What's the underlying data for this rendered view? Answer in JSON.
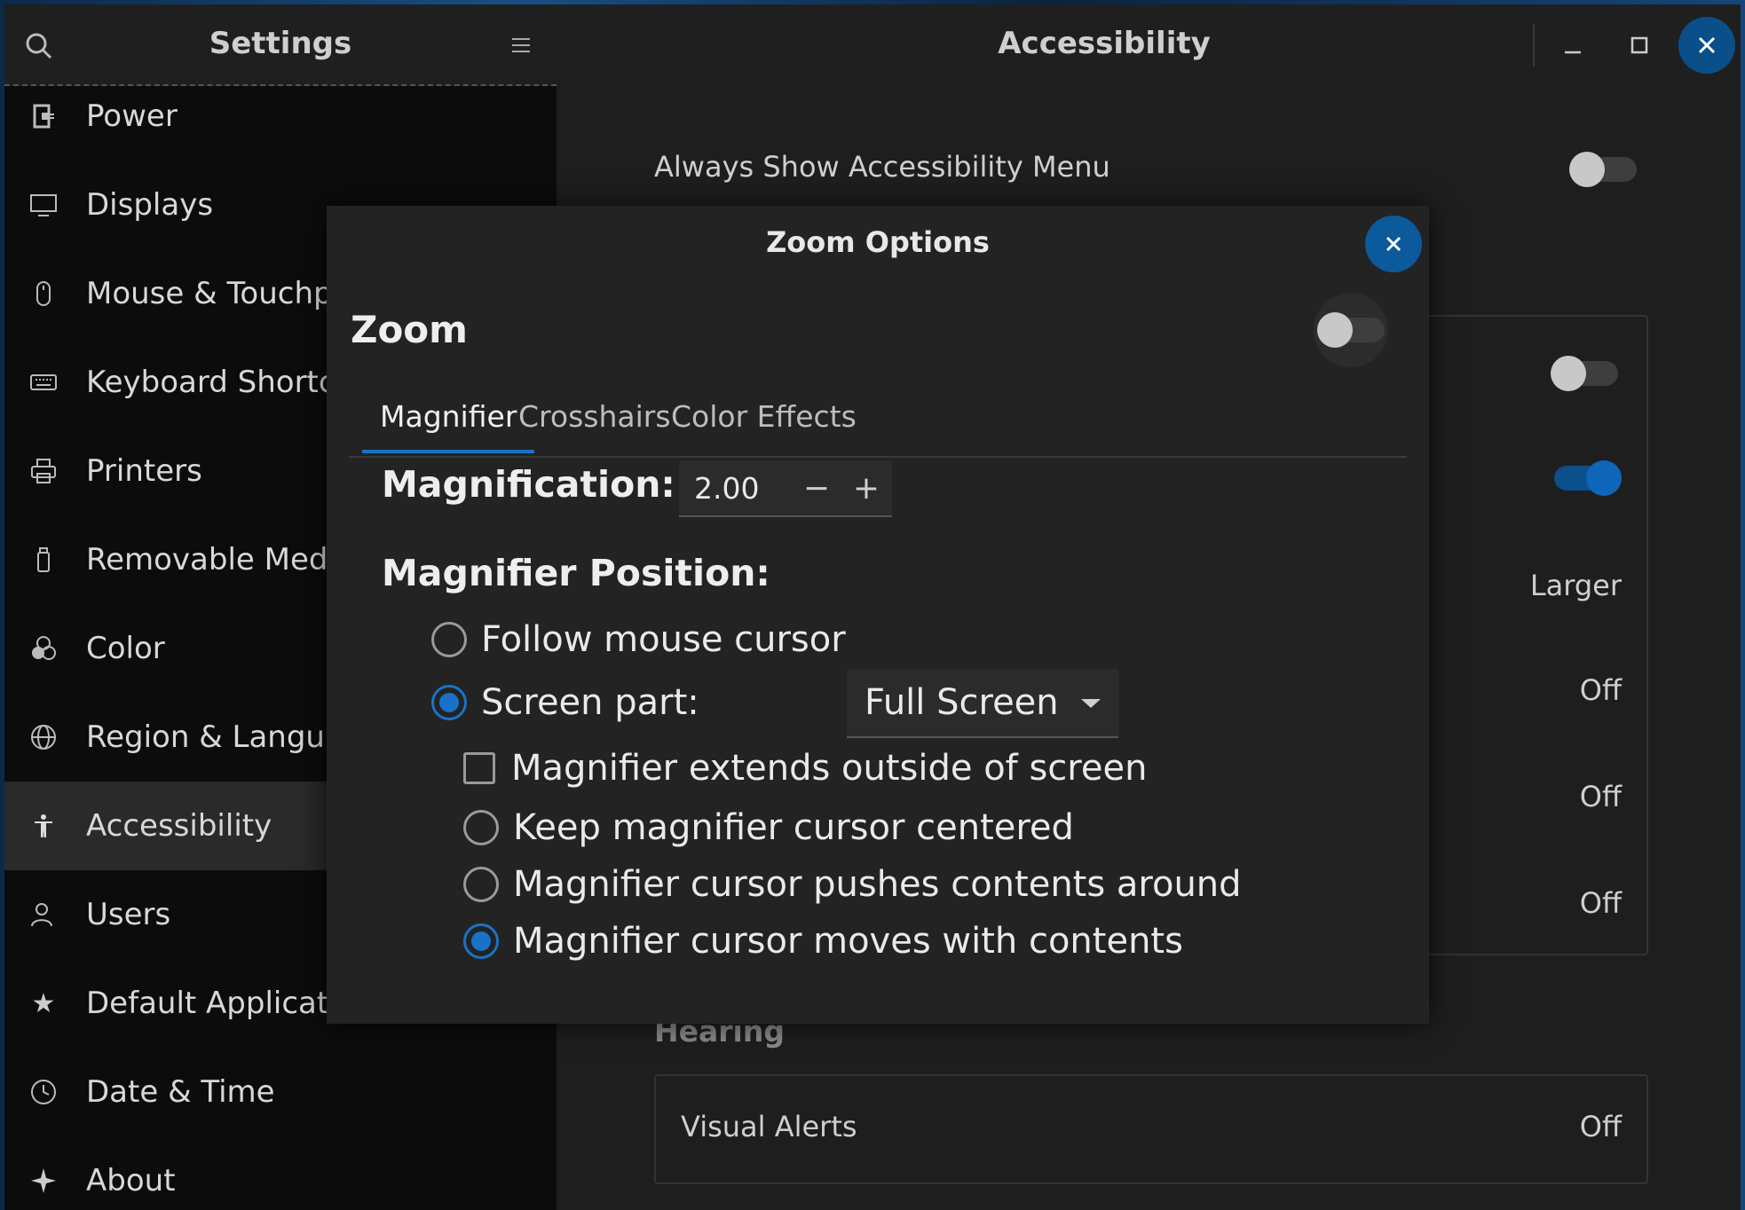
{
  "sidebar": {
    "title": "Settings",
    "items": [
      {
        "label": "Power",
        "icon": "power-plug-icon"
      },
      {
        "label": "Displays",
        "icon": "display-icon"
      },
      {
        "label": "Mouse & Touchpa",
        "icon": "mouse-icon"
      },
      {
        "label": "Keyboard Shortcu",
        "icon": "keyboard-icon"
      },
      {
        "label": "Printers",
        "icon": "printer-icon"
      },
      {
        "label": "Removable Media",
        "icon": "usb-drive-icon"
      },
      {
        "label": "Color",
        "icon": "color-circles-icon"
      },
      {
        "label": "Region & Languag",
        "icon": "globe-icon"
      },
      {
        "label": "Accessibility",
        "icon": "accessibility-person-icon",
        "active": true
      },
      {
        "label": "Users",
        "icon": "users-icon"
      },
      {
        "label": "Default Applicatio",
        "icon": "star-icon"
      },
      {
        "label": "Date & Time",
        "icon": "clock-icon"
      },
      {
        "label": "About",
        "icon": "sparkle-icon"
      }
    ]
  },
  "header": {
    "title": "Accessibility"
  },
  "main": {
    "always_show_menu": {
      "label": "Always Show Accessibility Menu",
      "on": false
    },
    "seeing_rows": [
      {
        "value": "",
        "switch": "off"
      },
      {
        "value": "",
        "switch": "on"
      },
      {
        "value": "Larger"
      },
      {
        "value": "Off"
      },
      {
        "value": "Off"
      },
      {
        "value": "Off"
      }
    ],
    "hearing_heading": "Hearing",
    "visual_alerts": {
      "label": "Visual Alerts",
      "value": "Off"
    }
  },
  "dialog": {
    "title": "Zoom Options",
    "zoom_label": "Zoom",
    "zoom_on": false,
    "tabs": [
      "Magnifier",
      "Crosshairs",
      "Color Effects"
    ],
    "active_tab": "Magnifier",
    "magnification_label": "Magnification:",
    "magnification_value": "2.00",
    "magnification_minus": "−",
    "magnification_plus": "+",
    "position_label": "Magnifier Position:",
    "follow_mouse": "Follow mouse cursor",
    "screen_part": "Screen part:",
    "screen_part_value": "Full Screen",
    "extends_outside": "Magnifier extends outside of screen",
    "keep_centered": "Keep magnifier cursor centered",
    "pushes_contents": "Magnifier cursor pushes contents around",
    "moves_with_contents": "Magnifier cursor moves with contents"
  },
  "colors": {
    "accent": "#1a72c8",
    "close_button": "#0a5a9c"
  }
}
